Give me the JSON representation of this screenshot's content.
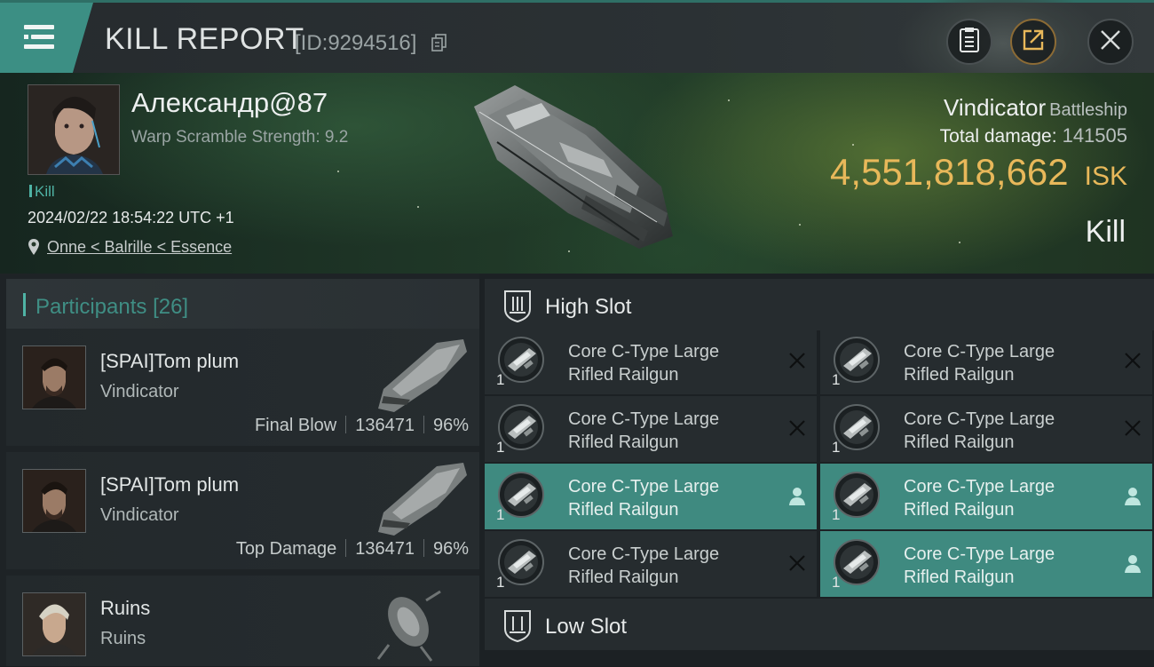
{
  "header": {
    "title": "KILL REPORT",
    "report_id": "[ID:9294516]",
    "icons": [
      "menu-icon",
      "copy-icon",
      "clipboard-icon",
      "share-icon",
      "close-icon"
    ]
  },
  "victim": {
    "name": "Александр@87",
    "warp_scramble": "Warp Scramble Strength: 9.2",
    "kill_tag": "Kill",
    "datetime": "2024/02/22 18:54:22 UTC +1",
    "location": "Onne < Balrille < Essence",
    "ship_name": "Vindicator",
    "ship_class": "Battleship",
    "total_damage_label": "Total damage:",
    "total_damage": "141505",
    "isk_value": "4,551,818,662",
    "isk_unit": "ISK",
    "result": "Kill"
  },
  "participants": {
    "label": "Participants",
    "count": "[26]",
    "items": [
      {
        "name": "[SPAI]Tom plum",
        "ship": "Vindicator",
        "role": "Final Blow",
        "damage": "136471",
        "percent": "96%"
      },
      {
        "name": "[SPAI]Tom plum",
        "ship": "Vindicator",
        "role": "Top Damage",
        "damage": "136471",
        "percent": "96%"
      },
      {
        "name": "Ruins",
        "ship": "Ruins",
        "role": "",
        "damage": "",
        "percent": ""
      }
    ]
  },
  "slots": {
    "high_label": "High Slot",
    "low_label": "Low Slot",
    "modules": [
      {
        "line1": "Core C-Type Large",
        "line2": "Rifled Railgun",
        "qty": "1",
        "state": "destroyed"
      },
      {
        "line1": "Core C-Type Large",
        "line2": "Rifled Railgun",
        "qty": "1",
        "state": "destroyed"
      },
      {
        "line1": "Core C-Type Large",
        "line2": "Rifled Railgun",
        "qty": "1",
        "state": "destroyed"
      },
      {
        "line1": "Core C-Type Large",
        "line2": "Rifled Railgun",
        "qty": "1",
        "state": "destroyed"
      },
      {
        "line1": "Core C-Type Large",
        "line2": "Rifled Railgun",
        "qty": "1",
        "state": "dropped"
      },
      {
        "line1": "Core C-Type Large",
        "line2": "Rifled Railgun",
        "qty": "1",
        "state": "dropped"
      },
      {
        "line1": "Core C-Type Large",
        "line2": "Rifled Railgun",
        "qty": "1",
        "state": "destroyed"
      },
      {
        "line1": "Core C-Type Large",
        "line2": "Rifled Railgun",
        "qty": "1",
        "state": "dropped"
      }
    ]
  },
  "colors": {
    "accent_teal": "#3f8a80",
    "isk_gold": "#e8b85a",
    "background": "#1a1e21"
  }
}
